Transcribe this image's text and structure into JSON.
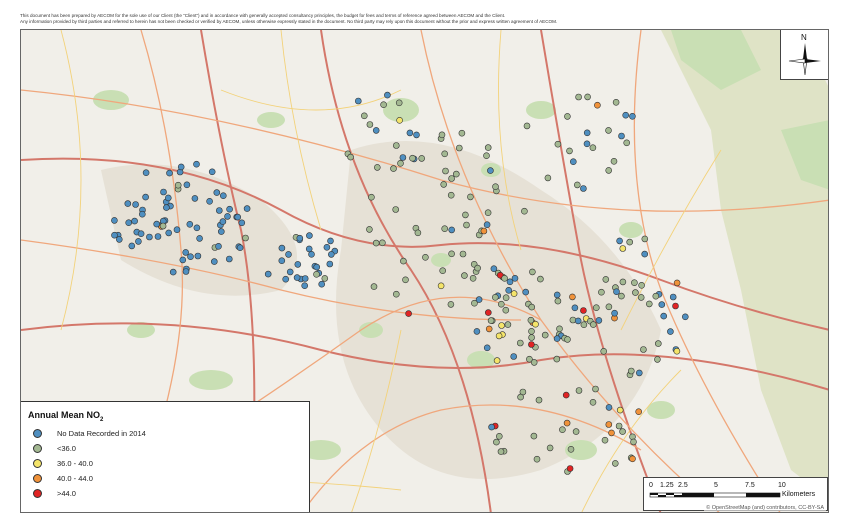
{
  "disclaimer": {
    "line1": "This document has been prepared by AECOM for the sole use of our Client (the “Client”) and in accordance with generally accepted consultancy principles, the budget for fees and terms of reference agreed between AECOM and the Client.",
    "line2": "Any information provided by third parties and referred to herein has not been checked or verified by AECOM, unless otherwise expressly stated in the document. No third party may rely upon this document without the prior and express written agreement of AECOM."
  },
  "legend": {
    "title_main": "Annual Mean NO",
    "title_sub": "2",
    "items": [
      {
        "label": "No Data Recorded in 2014",
        "color": "#4f8fc0"
      },
      {
        "label": "<36.0",
        "color": "#a3b892"
      },
      {
        "label": "36.0 - 40.0",
        "color": "#f4e46a"
      },
      {
        "label": "40.0 - 44.0",
        "color": "#f0923a"
      },
      {
        "label": ">44.0",
        "color": "#e02424"
      }
    ]
  },
  "north_arrow": {
    "letter": "N",
    "icon": "north-arrow-icon"
  },
  "scale_bar": {
    "ticks": [
      "0",
      "1.25",
      "2.5",
      "5",
      "7.5",
      "10"
    ],
    "unit": "Kilometers"
  },
  "attribution": "© OpenStreetMap (and) contributors, CC-BY-SA",
  "colors": {
    "map_background": "#f1efe9",
    "green_area": "#c9dfb4",
    "hill_area": "#dfe3c6",
    "urban_area": "#e6e1d6",
    "road_major": "#f0a77c",
    "road_secondary": "#f3d27a",
    "motorway": "#d4776a"
  }
}
